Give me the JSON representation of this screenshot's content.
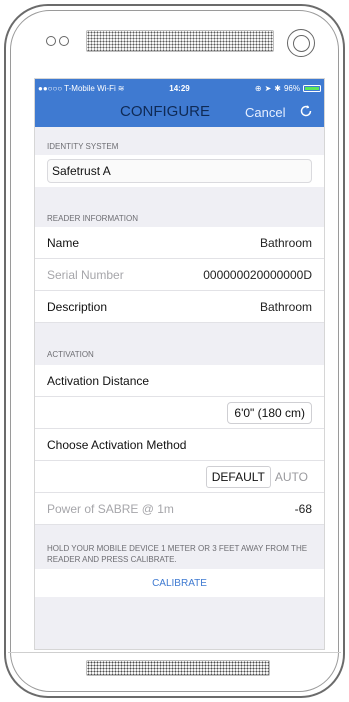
{
  "status_bar": {
    "carrier": "T-Mobile Wi-Fi",
    "time": "14:29",
    "battery": "96%"
  },
  "nav": {
    "title": "CONFIGURE",
    "cancel": "Cancel"
  },
  "identity_system": {
    "header": "IDENTITY SYSTEM",
    "value": "Safetrust A"
  },
  "reader_information": {
    "header": "READER INFORMATION",
    "rows": [
      {
        "label": "Name",
        "value": "Bathroom"
      },
      {
        "label": "Serial Number",
        "value": "000000020000000D"
      },
      {
        "label": "Description",
        "value": "Bathroom"
      }
    ]
  },
  "activation": {
    "header": "ACTIVATION",
    "distance_label": "Activation Distance",
    "distance_value": "6'0\" (180 cm)",
    "method_label": "Choose Activation Method",
    "method_options": [
      "DEFAULT",
      "AUTO"
    ],
    "power_label": "Power of SABRE @ 1m",
    "power_value": "-68"
  },
  "instructions": "HOLD YOUR MOBILE DEVICE 1 METER OR 3 FEET AWAY FROM THE READER AND PRESS CALIBRATE.",
  "calibrate_label": "CALIBRATE",
  "colors": {
    "accent": "#3f7ad1",
    "background": "#efeff4"
  }
}
